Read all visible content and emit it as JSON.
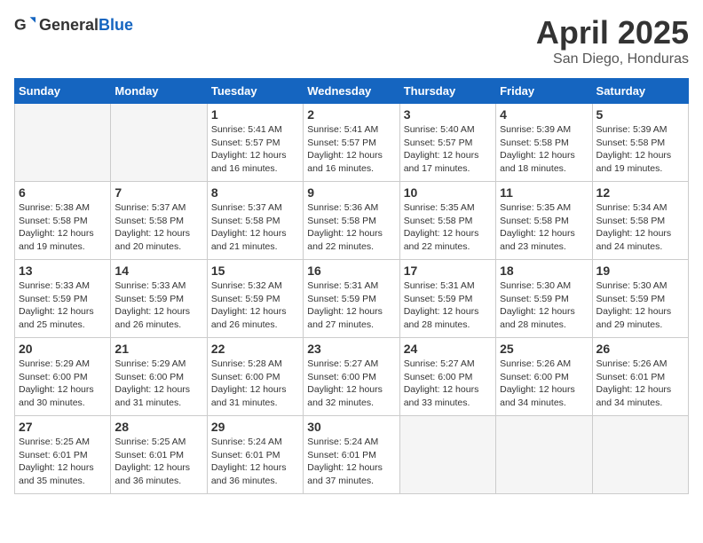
{
  "header": {
    "logo_general": "General",
    "logo_blue": "Blue",
    "title": "April 2025",
    "subtitle": "San Diego, Honduras"
  },
  "weekdays": [
    "Sunday",
    "Monday",
    "Tuesday",
    "Wednesday",
    "Thursday",
    "Friday",
    "Saturday"
  ],
  "weeks": [
    [
      {
        "day": "",
        "info": ""
      },
      {
        "day": "",
        "info": ""
      },
      {
        "day": "1",
        "info": "Sunrise: 5:41 AM\nSunset: 5:57 PM\nDaylight: 12 hours and 16 minutes."
      },
      {
        "day": "2",
        "info": "Sunrise: 5:41 AM\nSunset: 5:57 PM\nDaylight: 12 hours and 16 minutes."
      },
      {
        "day": "3",
        "info": "Sunrise: 5:40 AM\nSunset: 5:57 PM\nDaylight: 12 hours and 17 minutes."
      },
      {
        "day": "4",
        "info": "Sunrise: 5:39 AM\nSunset: 5:58 PM\nDaylight: 12 hours and 18 minutes."
      },
      {
        "day": "5",
        "info": "Sunrise: 5:39 AM\nSunset: 5:58 PM\nDaylight: 12 hours and 19 minutes."
      }
    ],
    [
      {
        "day": "6",
        "info": "Sunrise: 5:38 AM\nSunset: 5:58 PM\nDaylight: 12 hours and 19 minutes."
      },
      {
        "day": "7",
        "info": "Sunrise: 5:37 AM\nSunset: 5:58 PM\nDaylight: 12 hours and 20 minutes."
      },
      {
        "day": "8",
        "info": "Sunrise: 5:37 AM\nSunset: 5:58 PM\nDaylight: 12 hours and 21 minutes."
      },
      {
        "day": "9",
        "info": "Sunrise: 5:36 AM\nSunset: 5:58 PM\nDaylight: 12 hours and 22 minutes."
      },
      {
        "day": "10",
        "info": "Sunrise: 5:35 AM\nSunset: 5:58 PM\nDaylight: 12 hours and 22 minutes."
      },
      {
        "day": "11",
        "info": "Sunrise: 5:35 AM\nSunset: 5:58 PM\nDaylight: 12 hours and 23 minutes."
      },
      {
        "day": "12",
        "info": "Sunrise: 5:34 AM\nSunset: 5:58 PM\nDaylight: 12 hours and 24 minutes."
      }
    ],
    [
      {
        "day": "13",
        "info": "Sunrise: 5:33 AM\nSunset: 5:59 PM\nDaylight: 12 hours and 25 minutes."
      },
      {
        "day": "14",
        "info": "Sunrise: 5:33 AM\nSunset: 5:59 PM\nDaylight: 12 hours and 26 minutes."
      },
      {
        "day": "15",
        "info": "Sunrise: 5:32 AM\nSunset: 5:59 PM\nDaylight: 12 hours and 26 minutes."
      },
      {
        "day": "16",
        "info": "Sunrise: 5:31 AM\nSunset: 5:59 PM\nDaylight: 12 hours and 27 minutes."
      },
      {
        "day": "17",
        "info": "Sunrise: 5:31 AM\nSunset: 5:59 PM\nDaylight: 12 hours and 28 minutes."
      },
      {
        "day": "18",
        "info": "Sunrise: 5:30 AM\nSunset: 5:59 PM\nDaylight: 12 hours and 28 minutes."
      },
      {
        "day": "19",
        "info": "Sunrise: 5:30 AM\nSunset: 5:59 PM\nDaylight: 12 hours and 29 minutes."
      }
    ],
    [
      {
        "day": "20",
        "info": "Sunrise: 5:29 AM\nSunset: 6:00 PM\nDaylight: 12 hours and 30 minutes."
      },
      {
        "day": "21",
        "info": "Sunrise: 5:29 AM\nSunset: 6:00 PM\nDaylight: 12 hours and 31 minutes."
      },
      {
        "day": "22",
        "info": "Sunrise: 5:28 AM\nSunset: 6:00 PM\nDaylight: 12 hours and 31 minutes."
      },
      {
        "day": "23",
        "info": "Sunrise: 5:27 AM\nSunset: 6:00 PM\nDaylight: 12 hours and 32 minutes."
      },
      {
        "day": "24",
        "info": "Sunrise: 5:27 AM\nSunset: 6:00 PM\nDaylight: 12 hours and 33 minutes."
      },
      {
        "day": "25",
        "info": "Sunrise: 5:26 AM\nSunset: 6:00 PM\nDaylight: 12 hours and 34 minutes."
      },
      {
        "day": "26",
        "info": "Sunrise: 5:26 AM\nSunset: 6:01 PM\nDaylight: 12 hours and 34 minutes."
      }
    ],
    [
      {
        "day": "27",
        "info": "Sunrise: 5:25 AM\nSunset: 6:01 PM\nDaylight: 12 hours and 35 minutes."
      },
      {
        "day": "28",
        "info": "Sunrise: 5:25 AM\nSunset: 6:01 PM\nDaylight: 12 hours and 36 minutes."
      },
      {
        "day": "29",
        "info": "Sunrise: 5:24 AM\nSunset: 6:01 PM\nDaylight: 12 hours and 36 minutes."
      },
      {
        "day": "30",
        "info": "Sunrise: 5:24 AM\nSunset: 6:01 PM\nDaylight: 12 hours and 37 minutes."
      },
      {
        "day": "",
        "info": ""
      },
      {
        "day": "",
        "info": ""
      },
      {
        "day": "",
        "info": ""
      }
    ]
  ]
}
